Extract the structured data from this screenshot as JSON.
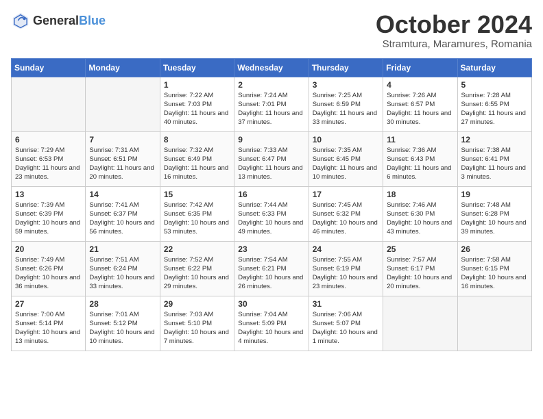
{
  "header": {
    "logo_general": "General",
    "logo_blue": "Blue",
    "month_title": "October 2024",
    "subtitle": "Stramtura, Maramures, Romania"
  },
  "weekdays": [
    "Sunday",
    "Monday",
    "Tuesday",
    "Wednesday",
    "Thursday",
    "Friday",
    "Saturday"
  ],
  "weeks": [
    [
      {
        "day": "",
        "empty": true
      },
      {
        "day": "",
        "empty": true
      },
      {
        "day": "1",
        "sunrise": "Sunrise: 7:22 AM",
        "sunset": "Sunset: 7:03 PM",
        "daylight": "Daylight: 11 hours and 40 minutes."
      },
      {
        "day": "2",
        "sunrise": "Sunrise: 7:24 AM",
        "sunset": "Sunset: 7:01 PM",
        "daylight": "Daylight: 11 hours and 37 minutes."
      },
      {
        "day": "3",
        "sunrise": "Sunrise: 7:25 AM",
        "sunset": "Sunset: 6:59 PM",
        "daylight": "Daylight: 11 hours and 33 minutes."
      },
      {
        "day": "4",
        "sunrise": "Sunrise: 7:26 AM",
        "sunset": "Sunset: 6:57 PM",
        "daylight": "Daylight: 11 hours and 30 minutes."
      },
      {
        "day": "5",
        "sunrise": "Sunrise: 7:28 AM",
        "sunset": "Sunset: 6:55 PM",
        "daylight": "Daylight: 11 hours and 27 minutes."
      }
    ],
    [
      {
        "day": "6",
        "sunrise": "Sunrise: 7:29 AM",
        "sunset": "Sunset: 6:53 PM",
        "daylight": "Daylight: 11 hours and 23 minutes."
      },
      {
        "day": "7",
        "sunrise": "Sunrise: 7:31 AM",
        "sunset": "Sunset: 6:51 PM",
        "daylight": "Daylight: 11 hours and 20 minutes."
      },
      {
        "day": "8",
        "sunrise": "Sunrise: 7:32 AM",
        "sunset": "Sunset: 6:49 PM",
        "daylight": "Daylight: 11 hours and 16 minutes."
      },
      {
        "day": "9",
        "sunrise": "Sunrise: 7:33 AM",
        "sunset": "Sunset: 6:47 PM",
        "daylight": "Daylight: 11 hours and 13 minutes."
      },
      {
        "day": "10",
        "sunrise": "Sunrise: 7:35 AM",
        "sunset": "Sunset: 6:45 PM",
        "daylight": "Daylight: 11 hours and 10 minutes."
      },
      {
        "day": "11",
        "sunrise": "Sunrise: 7:36 AM",
        "sunset": "Sunset: 6:43 PM",
        "daylight": "Daylight: 11 hours and 6 minutes."
      },
      {
        "day": "12",
        "sunrise": "Sunrise: 7:38 AM",
        "sunset": "Sunset: 6:41 PM",
        "daylight": "Daylight: 11 hours and 3 minutes."
      }
    ],
    [
      {
        "day": "13",
        "sunrise": "Sunrise: 7:39 AM",
        "sunset": "Sunset: 6:39 PM",
        "daylight": "Daylight: 10 hours and 59 minutes."
      },
      {
        "day": "14",
        "sunrise": "Sunrise: 7:41 AM",
        "sunset": "Sunset: 6:37 PM",
        "daylight": "Daylight: 10 hours and 56 minutes."
      },
      {
        "day": "15",
        "sunrise": "Sunrise: 7:42 AM",
        "sunset": "Sunset: 6:35 PM",
        "daylight": "Daylight: 10 hours and 53 minutes."
      },
      {
        "day": "16",
        "sunrise": "Sunrise: 7:44 AM",
        "sunset": "Sunset: 6:33 PM",
        "daylight": "Daylight: 10 hours and 49 minutes."
      },
      {
        "day": "17",
        "sunrise": "Sunrise: 7:45 AM",
        "sunset": "Sunset: 6:32 PM",
        "daylight": "Daylight: 10 hours and 46 minutes."
      },
      {
        "day": "18",
        "sunrise": "Sunrise: 7:46 AM",
        "sunset": "Sunset: 6:30 PM",
        "daylight": "Daylight: 10 hours and 43 minutes."
      },
      {
        "day": "19",
        "sunrise": "Sunrise: 7:48 AM",
        "sunset": "Sunset: 6:28 PM",
        "daylight": "Daylight: 10 hours and 39 minutes."
      }
    ],
    [
      {
        "day": "20",
        "sunrise": "Sunrise: 7:49 AM",
        "sunset": "Sunset: 6:26 PM",
        "daylight": "Daylight: 10 hours and 36 minutes."
      },
      {
        "day": "21",
        "sunrise": "Sunrise: 7:51 AM",
        "sunset": "Sunset: 6:24 PM",
        "daylight": "Daylight: 10 hours and 33 minutes."
      },
      {
        "day": "22",
        "sunrise": "Sunrise: 7:52 AM",
        "sunset": "Sunset: 6:22 PM",
        "daylight": "Daylight: 10 hours and 29 minutes."
      },
      {
        "day": "23",
        "sunrise": "Sunrise: 7:54 AM",
        "sunset": "Sunset: 6:21 PM",
        "daylight": "Daylight: 10 hours and 26 minutes."
      },
      {
        "day": "24",
        "sunrise": "Sunrise: 7:55 AM",
        "sunset": "Sunset: 6:19 PM",
        "daylight": "Daylight: 10 hours and 23 minutes."
      },
      {
        "day": "25",
        "sunrise": "Sunrise: 7:57 AM",
        "sunset": "Sunset: 6:17 PM",
        "daylight": "Daylight: 10 hours and 20 minutes."
      },
      {
        "day": "26",
        "sunrise": "Sunrise: 7:58 AM",
        "sunset": "Sunset: 6:15 PM",
        "daylight": "Daylight: 10 hours and 16 minutes."
      }
    ],
    [
      {
        "day": "27",
        "sunrise": "Sunrise: 7:00 AM",
        "sunset": "Sunset: 5:14 PM",
        "daylight": "Daylight: 10 hours and 13 minutes."
      },
      {
        "day": "28",
        "sunrise": "Sunrise: 7:01 AM",
        "sunset": "Sunset: 5:12 PM",
        "daylight": "Daylight: 10 hours and 10 minutes."
      },
      {
        "day": "29",
        "sunrise": "Sunrise: 7:03 AM",
        "sunset": "Sunset: 5:10 PM",
        "daylight": "Daylight: 10 hours and 7 minutes."
      },
      {
        "day": "30",
        "sunrise": "Sunrise: 7:04 AM",
        "sunset": "Sunset: 5:09 PM",
        "daylight": "Daylight: 10 hours and 4 minutes."
      },
      {
        "day": "31",
        "sunrise": "Sunrise: 7:06 AM",
        "sunset": "Sunset: 5:07 PM",
        "daylight": "Daylight: 10 hours and 1 minute."
      },
      {
        "day": "",
        "empty": true
      },
      {
        "day": "",
        "empty": true
      }
    ]
  ]
}
